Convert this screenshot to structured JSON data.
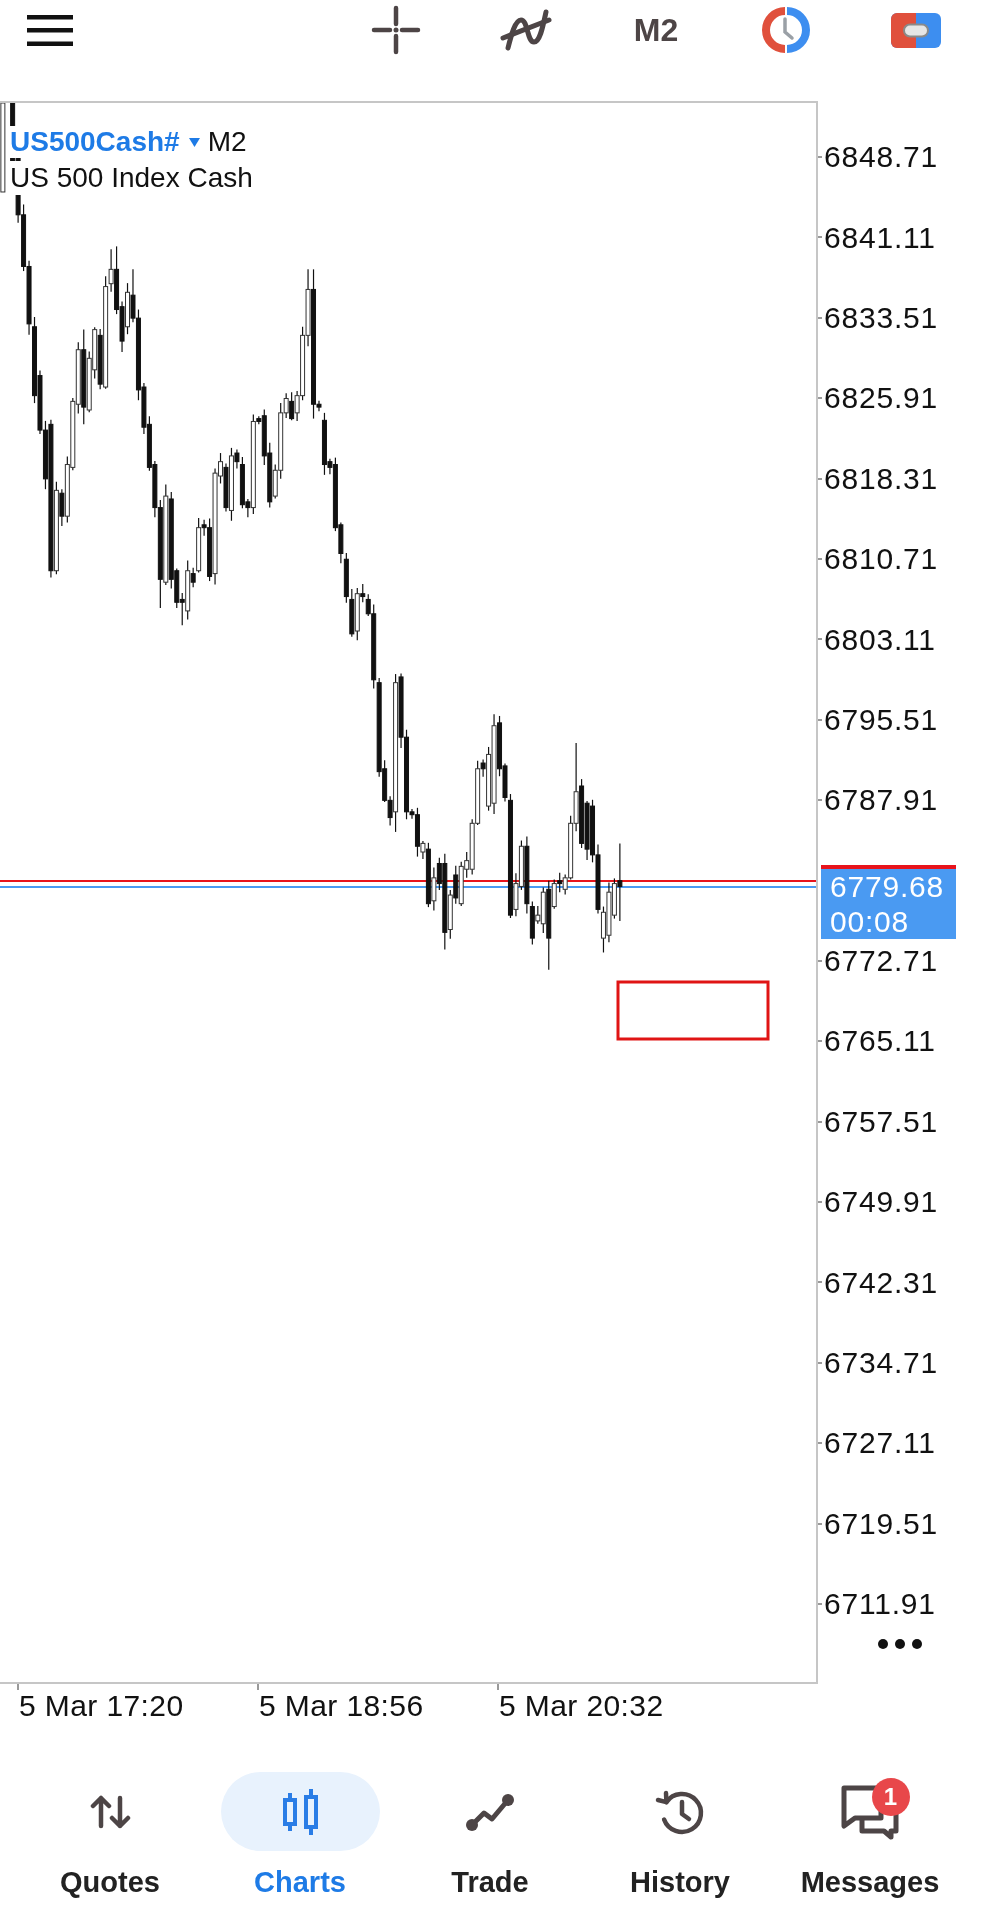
{
  "toolbar": {
    "timeframe": "M2"
  },
  "chart": {
    "symbol": "US500Cash#",
    "timeframe": "M2",
    "description": "US 500 Index Cash",
    "price_axis": {
      "above": [
        "6848.71",
        "6841.11",
        "6833.51",
        "6825.91",
        "6818.31",
        "6810.71",
        "6803.11",
        "6795.51",
        "6787.91"
      ],
      "current_price": {
        "price": "6779.68",
        "countdown": "00:08"
      },
      "below": [
        "6772.71",
        "6765.11",
        "6757.51",
        "6749.91",
        "6742.31",
        "6734.71",
        "6727.11",
        "6719.51",
        "6711.91"
      ]
    },
    "time_axis": [
      "5 Mar 17:20",
      "5 Mar 18:56",
      "5 Mar 20:32"
    ]
  },
  "nav": [
    {
      "kind": "quotes",
      "label": "Quotes",
      "selected": false
    },
    {
      "kind": "charts",
      "label": "Charts",
      "selected": true
    },
    {
      "kind": "trade",
      "label": "Trade",
      "selected": false
    },
    {
      "kind": "history",
      "label": "History",
      "selected": false
    },
    {
      "kind": "messages",
      "label": "Messages",
      "selected": false,
      "badge": "1"
    }
  ]
}
